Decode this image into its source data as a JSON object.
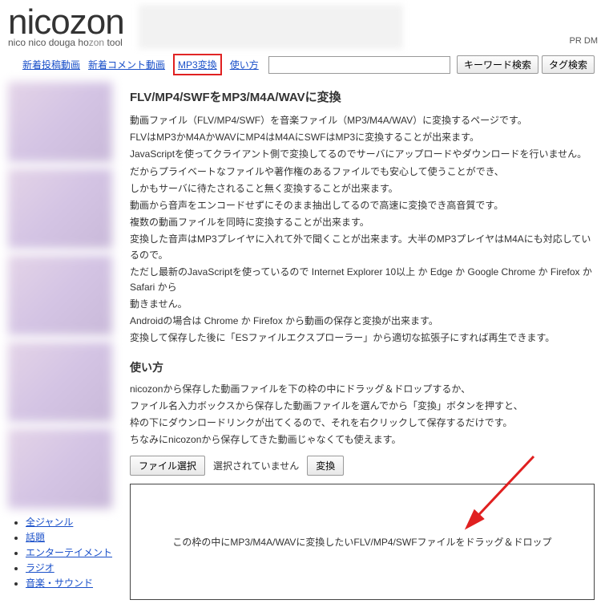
{
  "header": {
    "logo_main": "nicozon",
    "logo_sub_pre": "nico nico douga ho",
    "logo_sub_mid": "zon",
    "logo_sub_post": " tool",
    "pr_text": "PR DM"
  },
  "nav": {
    "link1": "新着投稿動画",
    "link2": "新着コメント動画",
    "link3": "MP3変換",
    "link4": "使い方",
    "search_placeholder": "",
    "btn_keyword": "キーワード検索",
    "btn_tag": "タグ検索"
  },
  "sidebar": {
    "links": {
      "l0": "全ジャンル",
      "l1": "話題",
      "l2": "エンターテイメント",
      "l3": "ラジオ",
      "l4": "音楽・サウンド"
    }
  },
  "main": {
    "title": "FLV/MP4/SWFをMP3/M4A/WAVに変換",
    "p1": "動画ファイル（FLV/MP4/SWF）を音楽ファイル（MP3/M4A/WAV）に変換するページです。",
    "p2": "FLVはMP3かM4AかWAVにMP4はM4AにSWFはMP3に変換することが出来ます。",
    "p3": "JavaScriptを使ってクライアント側で変換してるのでサーバにアップロードやダウンロードを行いません。",
    "p4": "だからプライベートなファイルや著作権のあるファイルでも安心して使うことができ、",
    "p5": "しかもサーバに待たされること無く変換することが出来ます。",
    "p6": "動画から音声をエンコードせずにそのまま抽出してるので高速に変換でき高音質です。",
    "p7": "複数の動画ファイルを同時に変換することが出来ます。",
    "p8": "変換した音声はMP3プレイヤに入れて外で聞くことが出来ます。大半のMP3プレイヤはM4Aにも対応しているので。",
    "p9": "ただし最新のJavaScriptを使っているので Internet Explorer 10以上 か Edge か Google Chrome か Firefox か Safari から",
    "p10": "動きません。",
    "p11": "Androidの場合は Chrome か Firefox から動画の保存と変換が出来ます。",
    "p12": "変換して保存した後に「ESファイルエクスプローラー」から適切な拡張子にすれば再生できます。",
    "subtitle": "使い方",
    "u1": "nicozonから保存した動画ファイルを下の枠の中にドラッグ＆ドロップするか、",
    "u2": "ファイル名入力ボックスから保存した動画ファイルを選んでから「変換」ボタンを押すと、",
    "u3": "枠の下にダウンロードリンクが出てくるので、それを右クリックして保存するだけです。",
    "u4": "ちなみにnicozonから保存してきた動画じゃなくても使えます。",
    "file_button": "ファイル選択",
    "file_status": "選択されていません",
    "convert_button": "変換",
    "dropzone_text": "この枠の中にMP3/M4A/WAVに変換したいFLV/MP4/SWFファイルをドラッグ＆ドロップ"
  }
}
